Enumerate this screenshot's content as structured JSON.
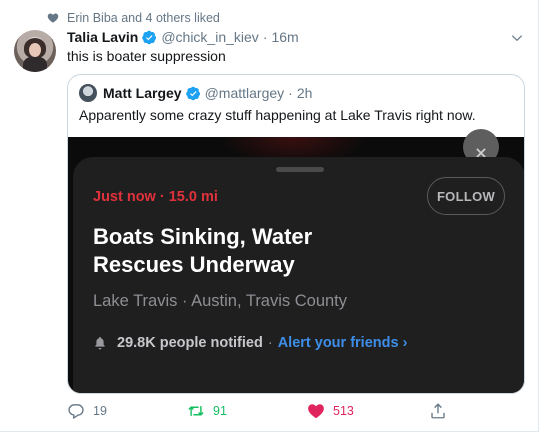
{
  "social_context": {
    "text": "Erin Biba and 4 others liked"
  },
  "tweet": {
    "author_name": "Talia Lavin",
    "handle": "@chick_in_kiev",
    "separator": "·",
    "time": "16m",
    "text": "this is boater suppression"
  },
  "quoted_tweet": {
    "author_name": "Matt Largey",
    "handle": "@mattlargey",
    "separator": "·",
    "time": "2h",
    "text": "Apparently some crazy stuff happening at Lake Travis right now."
  },
  "alert_card": {
    "meta": "Just now · 15.0 mi",
    "follow_label": "FOLLOW",
    "headline": "Boats Sinking, Water Rescues Underway",
    "location": "Lake Travis · Austin, Travis County",
    "notified": "29.8K people notified",
    "dot": "·",
    "alert_link": "Alert your friends ›"
  },
  "actions": {
    "reply_count": "19",
    "retweet_count": "91",
    "like_count": "513"
  },
  "colors": {
    "verified": "#1da1f2",
    "retweet": "#17bf63",
    "like": "#e0245e",
    "alert_red": "#e0323b",
    "link_blue": "#3d8ee8"
  },
  "icons": [
    "heart-icon",
    "verified-badge-icon",
    "chevron-down-icon",
    "close-icon",
    "bell-icon",
    "reply-icon",
    "retweet-icon",
    "like-icon",
    "share-icon"
  ]
}
